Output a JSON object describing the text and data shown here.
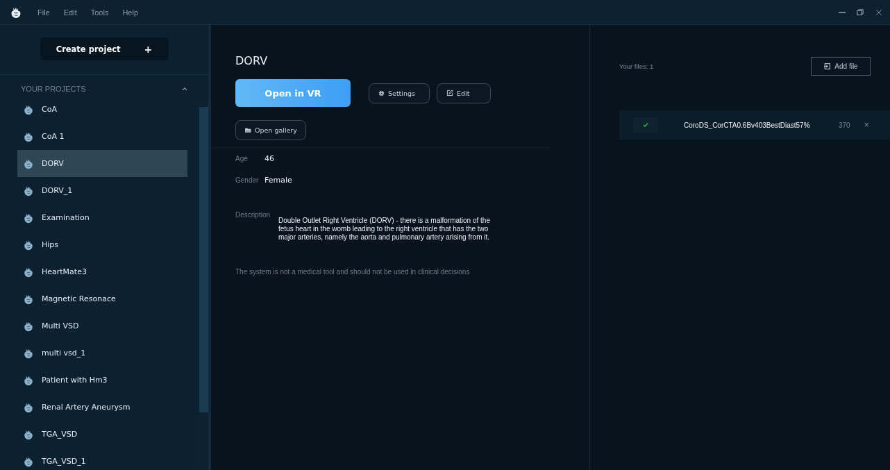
{
  "menu": [
    "File",
    "Edit",
    "Tools",
    "Help"
  ],
  "sidebar": {
    "create_button": "Create project",
    "create_icon": "+",
    "section_title": "YOUR PROJECTS",
    "expanded": true,
    "items": [
      {
        "label": "CoA",
        "selected": false
      },
      {
        "label": "CoA 1",
        "selected": false
      },
      {
        "label": "DORV",
        "selected": true
      },
      {
        "label": "DORV_1",
        "selected": false
      },
      {
        "label": "Examination",
        "selected": false
      },
      {
        "label": "Hips",
        "selected": false
      },
      {
        "label": "HeartMate3",
        "selected": false
      },
      {
        "label": "Magnetic Resonace",
        "selected": false
      },
      {
        "label": "Multi VSD",
        "selected": false
      },
      {
        "label": "multi vsd_1",
        "selected": false
      },
      {
        "label": "Patient with Hm3",
        "selected": false
      },
      {
        "label": "Renal Artery Aneurysm",
        "selected": false
      },
      {
        "label": "TGA_VSD",
        "selected": false
      },
      {
        "label": "TGA_VSD_1",
        "selected": false
      }
    ]
  },
  "project": {
    "title": "DORV",
    "open_vr": "Open in VR",
    "settings": "Settings",
    "edit": "Edit",
    "gallery": "Open gallery",
    "fields": [
      {
        "label": "Age",
        "value": "46"
      },
      {
        "label": "Gender",
        "value": "Female"
      }
    ],
    "description_label": "Description",
    "description": "Double Outlet Right Ventricle (DORV) - there is a malformation of the fetus heart in the womb leading to the right ventricle that has the two major arteries, namely the aorta and pulmonary artery arising from it.",
    "disclaimer": "The system is not a medical tool and should not be used in clinical decisions"
  },
  "files": {
    "count_label": "Your files: 1",
    "add_button": "Add file",
    "items": [
      {
        "name": "CoroDS_CorCTA0.6Bv403BestDiast57%",
        "size": "370",
        "checked": true,
        "remove": "×"
      }
    ]
  }
}
